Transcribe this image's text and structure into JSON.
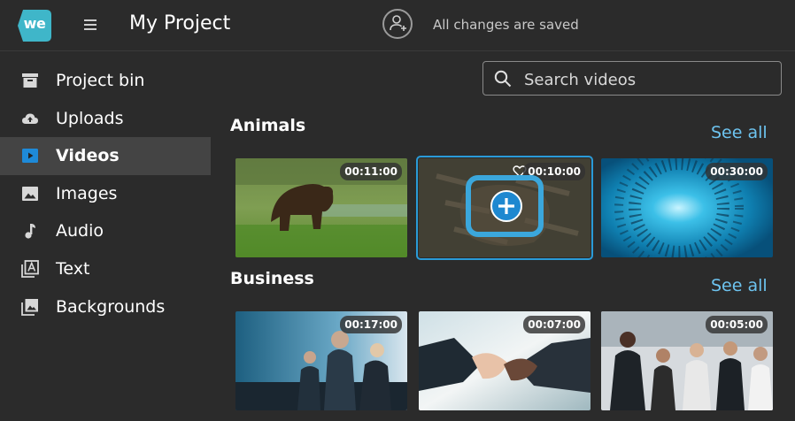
{
  "app": {
    "logo_text": "we",
    "title": "My Project",
    "save_status": "All changes are saved"
  },
  "sidebar": {
    "items": [
      {
        "label": "Project bin",
        "icon": "archive-icon",
        "active": false
      },
      {
        "label": "Uploads",
        "icon": "cloud-upload-icon",
        "active": false
      },
      {
        "label": "Videos",
        "icon": "video-icon",
        "active": true
      },
      {
        "label": "Images",
        "icon": "image-icon",
        "active": false
      },
      {
        "label": "Audio",
        "icon": "music-note-icon",
        "active": false
      },
      {
        "label": "Text",
        "icon": "text-icon",
        "active": false
      },
      {
        "label": "Backgrounds",
        "icon": "backgrounds-icon",
        "active": false
      }
    ]
  },
  "search": {
    "placeholder": "Search videos",
    "value": ""
  },
  "sections": [
    {
      "title": "Animals",
      "see_all": "See all",
      "videos": [
        {
          "duration": "00:11:00",
          "subject": "bear"
        },
        {
          "duration": "00:10:00",
          "subject": "tiger",
          "selected": true
        },
        {
          "duration": "00:30:00",
          "subject": "fish-school"
        }
      ]
    },
    {
      "title": "Business",
      "see_all": "See all",
      "videos": [
        {
          "duration": "00:17:00",
          "subject": "meeting"
        },
        {
          "duration": "00:07:00",
          "subject": "handshake"
        },
        {
          "duration": "00:05:00",
          "subject": "team"
        }
      ]
    }
  ],
  "colors": {
    "background": "#2b2b2b",
    "accent": "#6dc3ef",
    "logo": "#3fb6c9",
    "active_item": "#444444",
    "selection": "#3ba7dc"
  }
}
